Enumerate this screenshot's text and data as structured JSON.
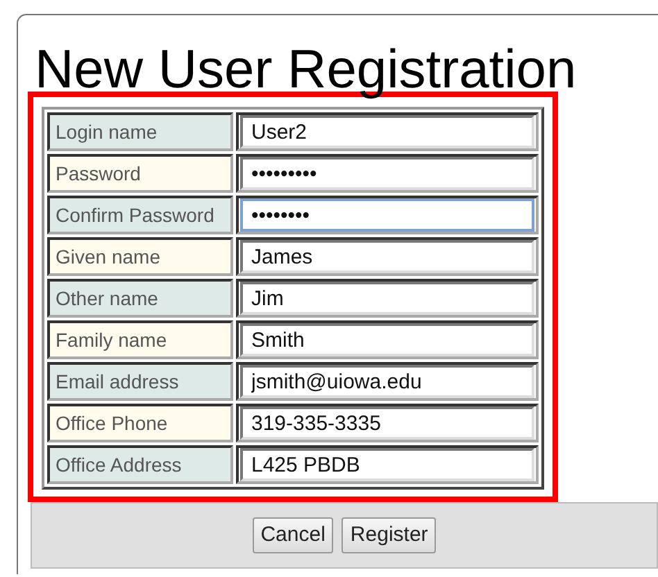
{
  "title": "New User Registration",
  "fields": [
    {
      "label": "Login name",
      "value": "User2",
      "focused": false
    },
    {
      "label": "Password",
      "value": "•••••••••",
      "focused": false
    },
    {
      "label": "Confirm Password",
      "value": "••••••••",
      "focused": true
    },
    {
      "label": "Given name",
      "value": "James",
      "focused": false
    },
    {
      "label": "Other name",
      "value": "Jim",
      "focused": false
    },
    {
      "label": "Family name",
      "value": "Smith",
      "focused": false
    },
    {
      "label": "Email address",
      "value": "jsmith@uiowa.edu",
      "focused": false
    },
    {
      "label": "Office Phone",
      "value": "319-335-3335",
      "focused": false
    },
    {
      "label": "Office Address",
      "value": "L425 PBDB",
      "focused": false
    }
  ],
  "buttons": [
    "Cancel",
    "Register"
  ]
}
